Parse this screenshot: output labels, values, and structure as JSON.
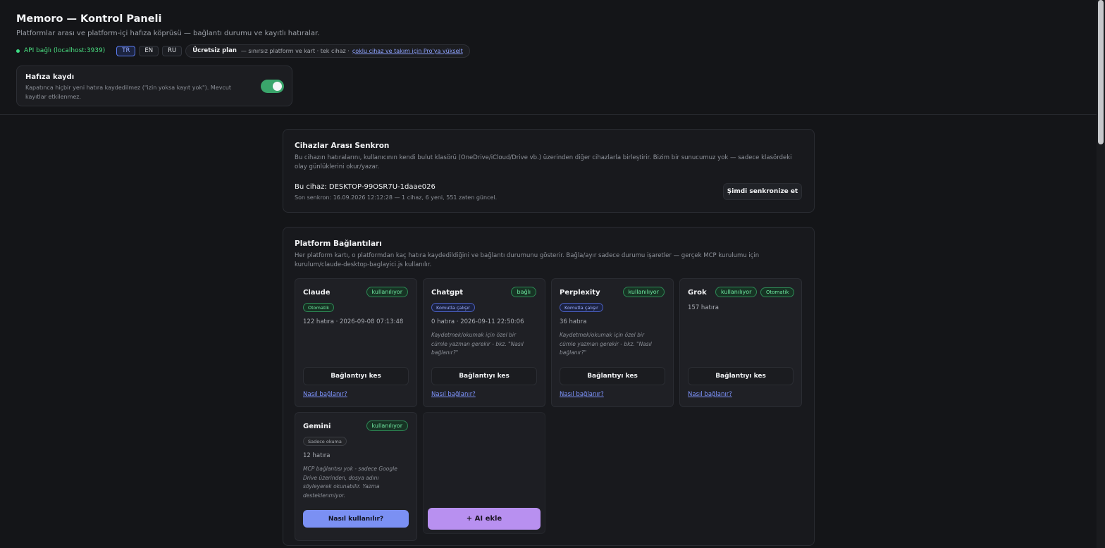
{
  "app": {
    "title": "Memoro — Kontrol Paneli",
    "subtitle": "Platformlar arası ve platform-içi hafıza köprüsü — bağlantı durumu ve kayıtlı hatıralar."
  },
  "status": {
    "api_text": "API bağlı (localhost:3939)",
    "languages": [
      {
        "label": "TR",
        "active": true
      },
      {
        "label": "EN",
        "active": false
      },
      {
        "label": "RU",
        "active": false
      }
    ],
    "plan_name": "Ücretsiz plan",
    "plan_desc": "— sınırsız platform ve kart · tek cihaz ·",
    "upgrade_link": "çoklu cihaz ve takım için Pro'ya yükselt"
  },
  "memory_toggle": {
    "title": "Hafıza kaydı",
    "description": "Kapatınca hiçbir yeni hatıra kaydedilmez (\"izin yoksa kayıt yok\"). Mevcut kayıtlar etkilenmez.",
    "enabled": true
  },
  "sync": {
    "title": "Cihazlar Arası Senkron",
    "description": "Bu cihazın hatıralarını, kullanıcının kendi bulut klasörü (OneDrive/iCloud/Drive vb.) üzerinden diğer cihazlarla birleştirir. Bizim bir sunucumuz yok — sadece klasördeki olay günlüklerini okur/yazar.",
    "device_label": "Bu cihaz: DESKTOP-99OSR7U-1daae026",
    "last_sync": "Son senkron: 16.09.2026 12:12:28 — 1 cihaz, 6 yeni, 551 zaten güncel.",
    "sync_button": "Şimdi senkronize et"
  },
  "platforms": {
    "title": "Platform Bağlantıları",
    "description": "Her platform kartı, o platformdan kaç hatıra kaydedildiğini ve bağlantı durumunu gösterir. Bağla/ayır sadece durumu işaretler — gerçek MCP kurulumu için kurulum/claude-desktop-baglayici.js kullanılır.",
    "cards": [
      {
        "name": "Claude",
        "status": "kullanılıyor",
        "tag": "Otomatik",
        "stats": "122 hatıra · 2026-09-08 07:13:48",
        "note": "",
        "button": "Bağlantıyı kes",
        "link": "Nasıl bağlanır?"
      },
      {
        "name": "Chatgpt",
        "status": "bağlı",
        "tag": "Komutla çalışır",
        "stats": "0 hatıra · 2026-09-11 22:50:06",
        "note": "Kaydetmek/okumak için özel bir cümle yazman gerekir - bkz. \"Nasıl bağlanır?\"",
        "button": "Bağlantıyı kes",
        "link": "Nasıl bağlanır?"
      },
      {
        "name": "Perplexity",
        "status": "kullanılıyor",
        "tag": "Komutla çalışır",
        "stats": "36 hatıra",
        "note": "Kaydetmek/okumak için özel bir cümle yazman gerekir - bkz. \"Nasıl bağlanır?\"",
        "button": "Bağlantıyı kes",
        "link": "Nasıl bağlanır?"
      },
      {
        "name": "Grok",
        "status": "kullanılıyor",
        "status2": "Otomatik",
        "stats": "157 hatıra",
        "note": "",
        "button": "Bağlantıyı kes",
        "link": "Nasıl bağlanır?"
      },
      {
        "name": "Gemini",
        "status": "kullanılıyor",
        "tag": "Sadece okuma",
        "stats": "12 hatıra",
        "note": "MCP bağlantısı yok - sadece Google Drive üzerinden, dosya adını söyleyerek okunabilir. Yazma desteklenmiyor.",
        "button": "Nasıl kullanılır?"
      }
    ],
    "add_button": "+ AI ekle"
  },
  "colors": {
    "background": "#141518",
    "accent_green": "#3aa56b",
    "link_blue": "#7f95ff",
    "primary_button": "#7b90f3",
    "add_button": "#b890f0"
  }
}
